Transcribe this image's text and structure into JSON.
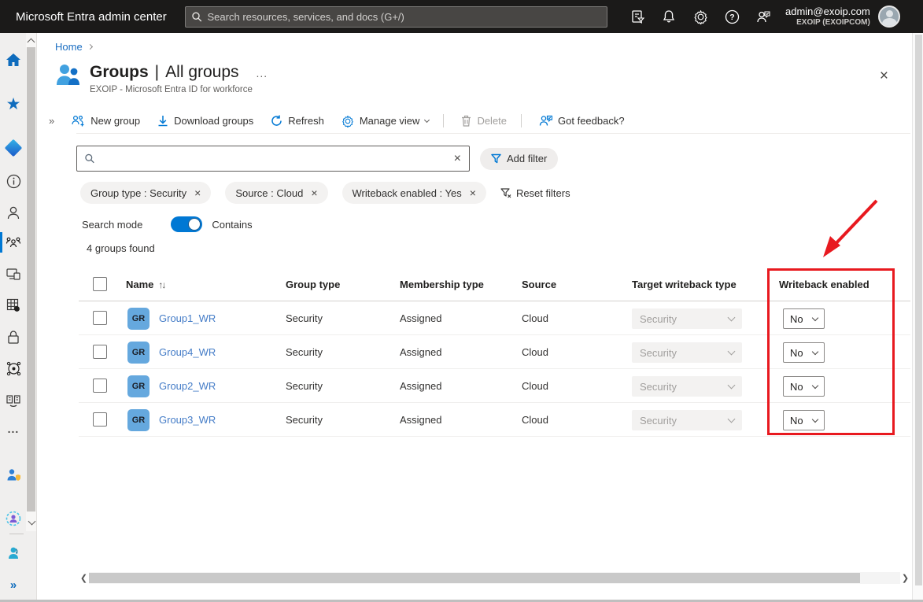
{
  "topbar": {
    "brand": "Microsoft Entra admin center",
    "search_placeholder": "Search resources, services, and docs (G+/)",
    "icons": [
      "directory-filter-icon",
      "notifications-bell-icon",
      "settings-gear-icon",
      "help-icon",
      "feedback-icon"
    ],
    "account": {
      "email": "admin@exoip.com",
      "tenant": "EXOIP (EXOIPCOM)"
    }
  },
  "breadcrumb": {
    "home": "Home"
  },
  "page": {
    "title_primary": "Groups",
    "title_divider": "|",
    "title_secondary": "All groups",
    "overflow": "...",
    "subtitle": "EXOIP - Microsoft Entra ID for workforce",
    "close": "×"
  },
  "toolbar": {
    "collapse": "»",
    "new_group": "New group",
    "download_groups": "Download groups",
    "refresh": "Refresh",
    "manage_view": "Manage view",
    "delete": "Delete",
    "feedback": "Got feedback?"
  },
  "filters": {
    "add_filter": "Add filter",
    "pills": [
      {
        "label": "Group type : Security",
        "remove": "×"
      },
      {
        "label": "Source : Cloud",
        "remove": "×"
      },
      {
        "label": "Writeback enabled : Yes",
        "remove": "×"
      }
    ],
    "reset": "Reset filters",
    "clear_search": "×"
  },
  "search_mode": {
    "label": "Search mode",
    "value": "Contains",
    "toggle_state": "on"
  },
  "results_count": "4 groups found",
  "table": {
    "headers": [
      "Name",
      "Group type",
      "Membership type",
      "Source",
      "Target writeback type",
      "Writeback enabled"
    ],
    "sort_glyph": "↑↓",
    "rows": [
      {
        "avatar": "GR",
        "name": "Group1_WR",
        "group_type": "Security",
        "membership_type": "Assigned",
        "source": "Cloud",
        "target_writeback_type": "Security",
        "writeback_enabled": "No"
      },
      {
        "avatar": "GR",
        "name": "Group4_WR",
        "group_type": "Security",
        "membership_type": "Assigned",
        "source": "Cloud",
        "target_writeback_type": "Security",
        "writeback_enabled": "No"
      },
      {
        "avatar": "GR",
        "name": "Group2_WR",
        "group_type": "Security",
        "membership_type": "Assigned",
        "source": "Cloud",
        "target_writeback_type": "Security",
        "writeback_enabled": "No"
      },
      {
        "avatar": "GR",
        "name": "Group3_WR",
        "group_type": "Security",
        "membership_type": "Assigned",
        "source": "Cloud",
        "target_writeback_type": "Security",
        "writeback_enabled": "No"
      }
    ]
  },
  "sidebar": {
    "items": [
      "home-icon",
      "favorites-star-icon",
      "entra-id-icon",
      "info-icon",
      "users-icon",
      "groups-icon",
      "devices-icon",
      "applications-icon",
      "protection-lock-icon",
      "identity-governance-icon",
      "external-identities-icon",
      "more-ellipsis-icon",
      "user-shield-icon",
      "user-circle-icon",
      "learn-support-icon",
      "expand-chevrons-icon"
    ],
    "selected": "groups-icon",
    "more_glyph": "...",
    "expand_glyph": "»"
  },
  "colors": {
    "accent": "#0078d4",
    "topbar_bg": "#1b1a19",
    "annotation_red": "#e8191f",
    "link": "#447cc7",
    "disabled": "#a19f9d",
    "avatar_bg": "#65a8de"
  }
}
